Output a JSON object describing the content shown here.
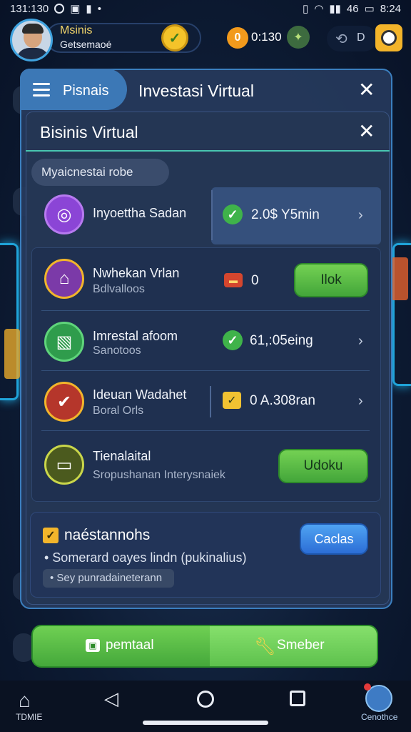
{
  "status": {
    "time": "131:130",
    "right_time": "8:24",
    "network": "46"
  },
  "topbar": {
    "name_line1": "Msinis",
    "name_line2": "Getsemaoé",
    "coin_symbol": "0",
    "coin_value": "0:130",
    "counter": "D"
  },
  "outer": {
    "tab_label": "Pisnais",
    "title": "Investasi Virtual"
  },
  "inner": {
    "title": "Bisinis Virtual",
    "chip": "Myaicnestai robe"
  },
  "rows": [
    {
      "title": "Inyoettha Sadan",
      "subtitle": "",
      "value": "2.0$ Y5min"
    },
    {
      "title": "Nwhekan Vrlan",
      "subtitle": "Bdlvalloos",
      "value": "0",
      "button": "Ilok"
    },
    {
      "title": "Imrestal afoom",
      "subtitle": "Sanotoos",
      "value": "61,:05eing"
    },
    {
      "title": "Ideuan Wadahet",
      "subtitle": "Boral Orls",
      "value": "0 A.308ran"
    },
    {
      "title": "Tienalaital",
      "subtitle": "Sropushanan Interysnaiek",
      "button": "Udoku"
    }
  ],
  "notes": {
    "title": "naéstannohs",
    "line": "• Somerard oayes lindn (pukinalius)",
    "field": "• Sey punradaineterann",
    "button": "Caclas"
  },
  "actionbar": {
    "left_label": "pemtaal",
    "right_label": "Smeber"
  },
  "nav": {
    "home_label": "TDMIE",
    "profile_label": "Cenothce"
  }
}
